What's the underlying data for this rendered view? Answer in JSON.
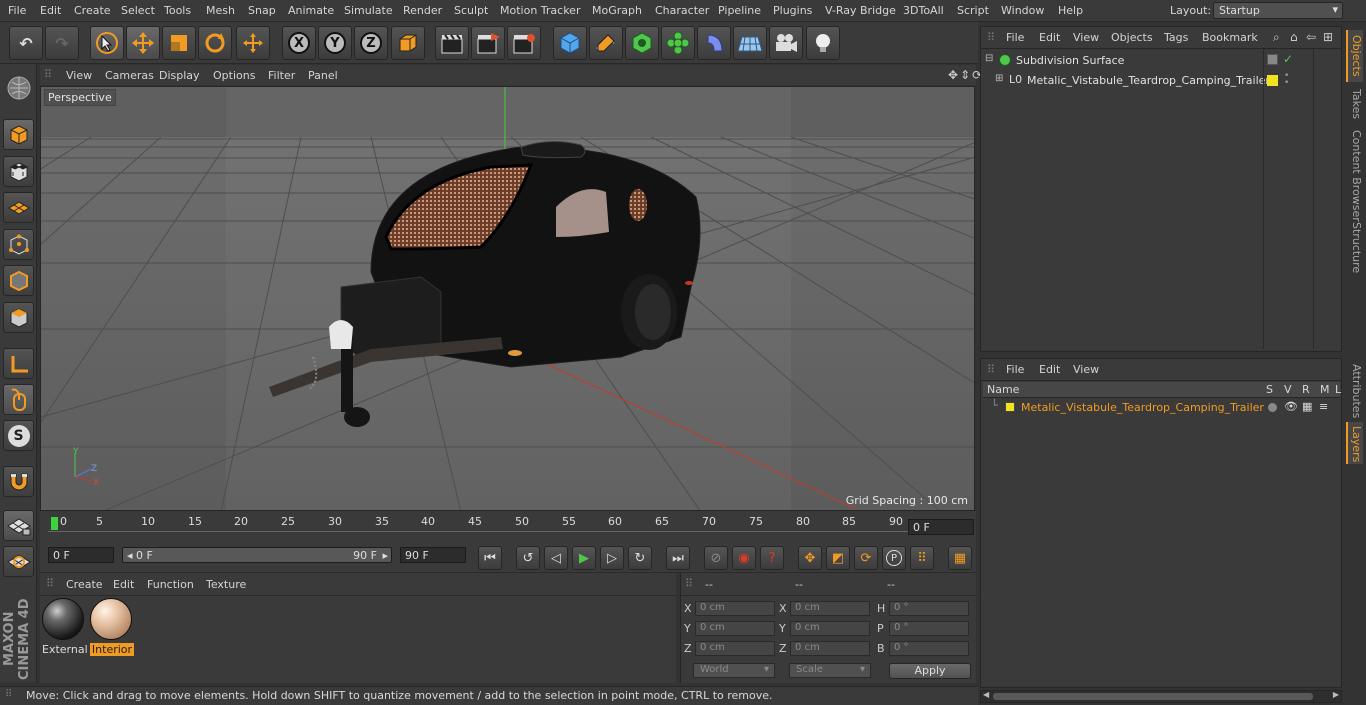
{
  "menu": [
    "File",
    "Edit",
    "Create",
    "Select",
    "Tools",
    "Mesh",
    "Snap",
    "Animate",
    "Simulate",
    "Render",
    "Sculpt",
    "Motion Tracker",
    "MoGraph",
    "Character",
    "Pipeline",
    "Plugins",
    "V-Ray Bridge",
    "3DToAll",
    "Script",
    "Window",
    "Help"
  ],
  "layout": {
    "label": "Layout:",
    "value": "Startup"
  },
  "toolbar": {
    "x": "X",
    "y": "Y",
    "z": "Z"
  },
  "left_tools": {
    "s_label": "S"
  },
  "brand": "MAXON CINEMA 4D",
  "viewport": {
    "menus": [
      "View",
      "Cameras",
      "Display",
      "Options",
      "Filter",
      "Panel"
    ],
    "label": "Perspective",
    "grid_spacing": "Grid Spacing : 100 cm",
    "axes": {
      "x": "X",
      "y": "Y",
      "z": "Z"
    }
  },
  "timeline": {
    "ticks": [
      "0",
      "5",
      "10",
      "15",
      "20",
      "25",
      "30",
      "35",
      "40",
      "45",
      "50",
      "55",
      "60",
      "65",
      "70",
      "75",
      "80",
      "85",
      "90"
    ],
    "current": "0 F",
    "start": "0 F",
    "range_start": "0 F",
    "range_end": "90 F",
    "end": "90 F"
  },
  "materials": {
    "menus": [
      "Create",
      "Edit",
      "Function",
      "Texture"
    ],
    "items": [
      {
        "label": "External"
      },
      {
        "label": "Interior"
      }
    ]
  },
  "coords": {
    "headers": [
      "--",
      "--",
      "--"
    ],
    "rows": [
      {
        "a": "X",
        "av": "0 cm",
        "b": "X",
        "bv": "0 cm",
        "c": "H",
        "cv": "0 °"
      },
      {
        "a": "Y",
        "av": "0 cm",
        "b": "Y",
        "bv": "0 cm",
        "c": "P",
        "cv": "0 °"
      },
      {
        "a": "Z",
        "av": "0 cm",
        "b": "Z",
        "bv": "0 cm",
        "c": "B",
        "cv": "0 °"
      }
    ],
    "world": "World",
    "scale": "Scale",
    "apply": "Apply"
  },
  "status": "Move: Click and drag to move elements. Hold down SHIFT to quantize movement / add to the selection in point mode, CTRL to remove.",
  "objects": {
    "menus": [
      "File",
      "Edit",
      "View",
      "Objects",
      "Tags",
      "Bookmark"
    ],
    "items": [
      {
        "name": "Subdivision Surface"
      },
      {
        "name": "Metalic_Vistabule_Teardrop_Camping_Trailer"
      }
    ]
  },
  "layers": {
    "menus": [
      "File",
      "Edit",
      "View"
    ],
    "columns": {
      "name": "Name",
      "s": "S",
      "v": "V",
      "r": "R",
      "m": "M",
      "l": "L"
    },
    "items": [
      {
        "name": "Metalic_Vistabule_Teardrop_Camping_Trailer",
        "color": "#f2e31e"
      }
    ]
  },
  "side_tabs": [
    "Objects",
    "Takes",
    "Content Browser",
    "Structure",
    "Attributes",
    "Layers"
  ],
  "colors": {
    "accent": "#f29b22",
    "layer_yellow": "#f2e31e"
  }
}
